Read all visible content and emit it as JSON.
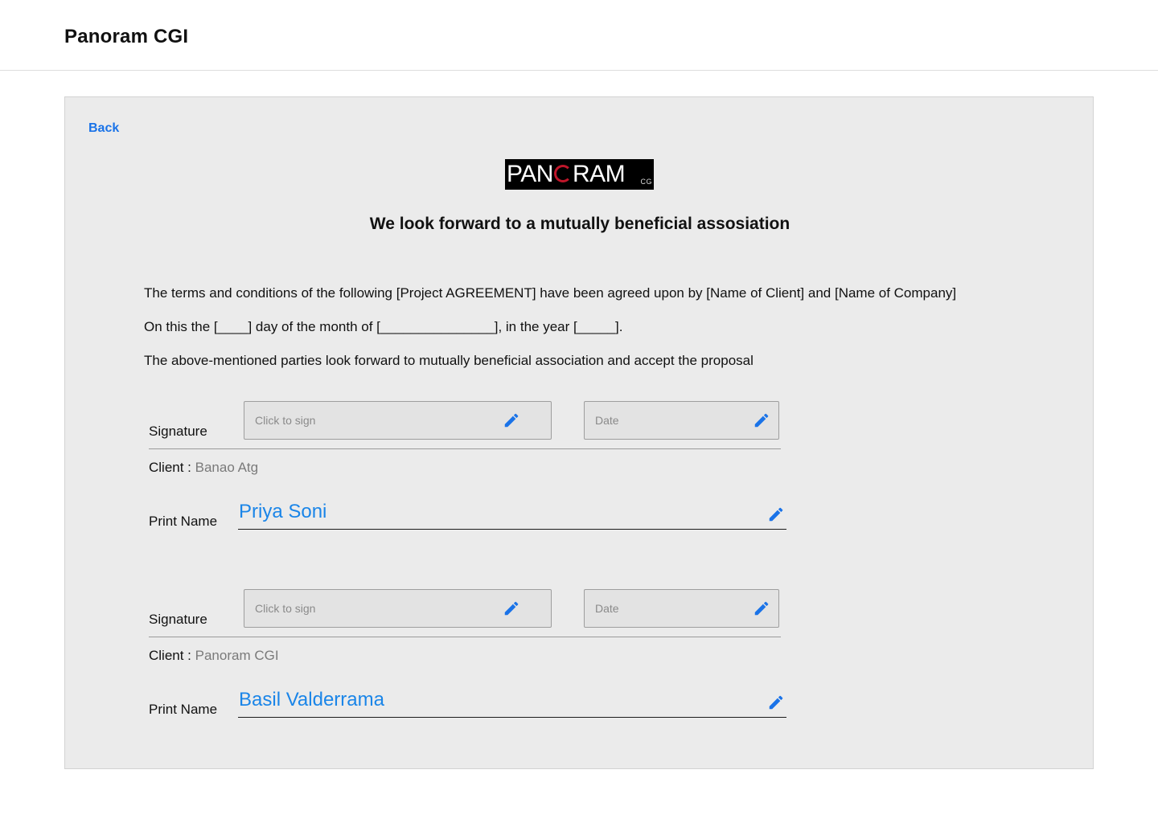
{
  "app": {
    "title": "Panoram CGI"
  },
  "back": {
    "label": "Back"
  },
  "logo": {
    "text_left": "PAN",
    "text_right": "RAM",
    "suffix": "CG"
  },
  "heading": "We look forward to a mutually beneficial assosiation",
  "paragraphs": [
    "The terms and conditions of the following [Project AGREEMENT] have been agreed upon by  [Name of Client]  and [Name of Company]",
    "On this the [____] day of the month of [_______________], in the year [_____].",
    "The above-mentioned parties look forward to mutually beneficial association and accept the proposal"
  ],
  "blocks": [
    {
      "signature_label": "Signature",
      "sign_placeholder": "Click to sign",
      "date_placeholder": "Date",
      "client_key": "Client : ",
      "client_value": "Banao Atg",
      "print_label": "Print Name",
      "print_value": "Priya Soni"
    },
    {
      "signature_label": "Signature",
      "sign_placeholder": "Click to sign",
      "date_placeholder": "Date",
      "client_key": "Client : ",
      "client_value": "Panoram CGI",
      "print_label": "Print Name",
      "print_value": "Basil Valderrama"
    }
  ],
  "colors": {
    "accent": "#1a73e8",
    "name_blue": "#1a85e8",
    "card_bg": "#ebebeb",
    "logo_ring": "#c0162a"
  },
  "icons": {
    "edit": "pencil-icon"
  }
}
